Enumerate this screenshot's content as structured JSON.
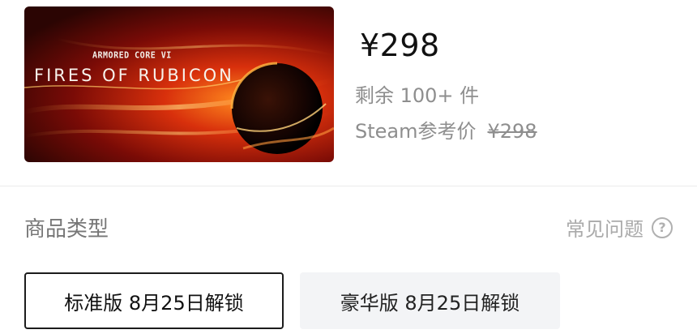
{
  "product": {
    "cover": {
      "logo_line1": "ARMORED CORE VI",
      "logo_line2": "FIRES OF RUBICON"
    },
    "price": "¥298",
    "stock": "剩余 100+ 件",
    "steam_ref_label": "Steam参考价",
    "steam_ref_price": "¥298"
  },
  "type_section": {
    "title": "商品类型",
    "faq_label": "常见问题",
    "help_icon": "?",
    "options": [
      {
        "label": "标准版 8月25日解锁",
        "selected": true
      },
      {
        "label": "豪华版 8月25日解锁",
        "selected": false
      }
    ]
  },
  "colors": {
    "selected_border": "#1c1c1c",
    "option_bg": "#f3f4f6",
    "muted_text": "#8e8e8e"
  }
}
